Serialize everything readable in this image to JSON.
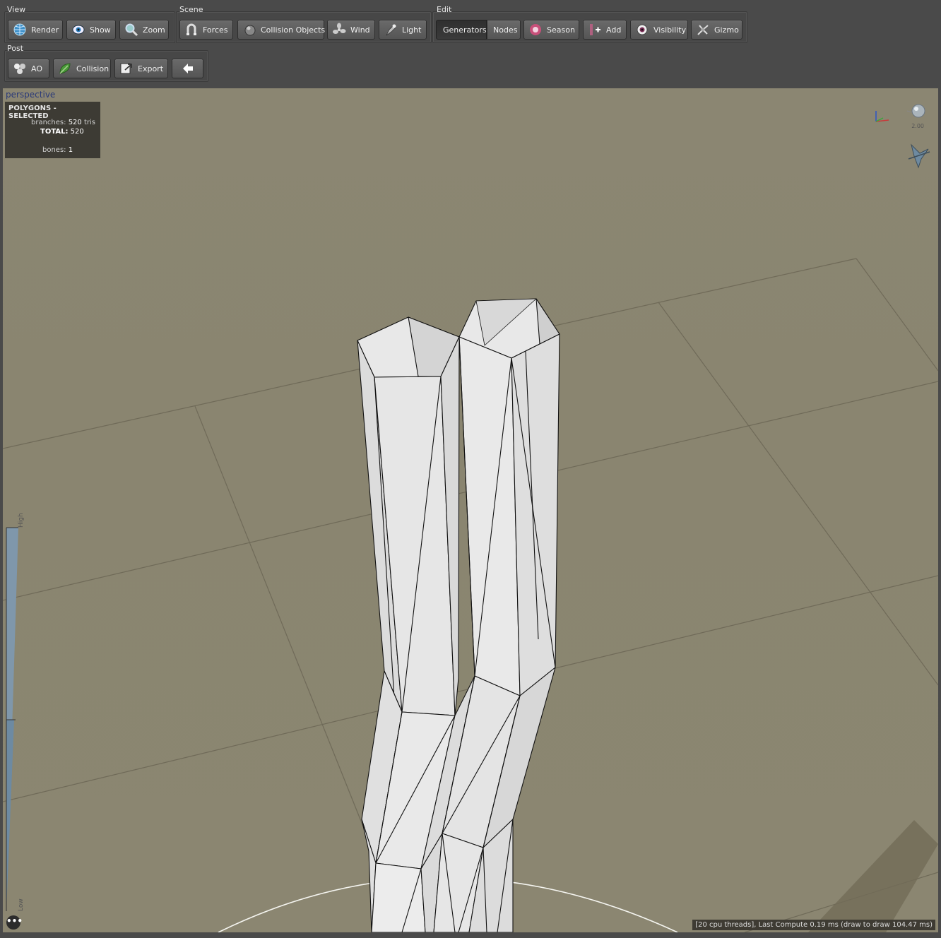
{
  "toolbar": {
    "view": {
      "title": "View",
      "buttons": [
        {
          "label": "Render",
          "icon": "globe-icon"
        },
        {
          "label": "Show",
          "icon": "eye-icon"
        },
        {
          "label": "Zoom",
          "icon": "magnifier-icon"
        }
      ]
    },
    "scene": {
      "title": "Scene",
      "buttons": [
        {
          "label": "Forces",
          "icon": "magnet-icon"
        },
        {
          "label": "Collision Objects",
          "icon": "sphere-icon"
        },
        {
          "label": "Wind",
          "icon": "fan-icon"
        },
        {
          "label": "Light",
          "icon": "lamp-icon"
        }
      ]
    },
    "edit": {
      "title": "Edit",
      "buttons": [
        {
          "label": "Generators",
          "active": true
        },
        {
          "label": "Nodes"
        },
        {
          "label": "Season",
          "icon": "season-icon"
        },
        {
          "label": "Add",
          "icon": "add-icon"
        },
        {
          "label": "Visibility",
          "icon": "eye-visibility-icon"
        },
        {
          "label": "Gizmo",
          "icon": "gizmo-icon"
        }
      ]
    },
    "post": {
      "title": "Post",
      "buttons": [
        {
          "label": "AO",
          "icon": "ao-spheres-icon"
        },
        {
          "label": "Collision",
          "icon": "leaf-icon"
        },
        {
          "label": "Export",
          "icon": "export-icon"
        },
        {
          "label": "",
          "icon": "back-arrow-icon"
        }
      ]
    }
  },
  "viewport": {
    "camera_label": "perspective",
    "stats": {
      "title": "POLYGONS - SELECTED",
      "branches_label": "branches:",
      "branches_value": "520",
      "branches_unit": "tris",
      "total_label": "TOTAL:",
      "total_value": "520",
      "bones_label": "bones:",
      "bones_value": "1"
    },
    "gizmo_scale": "2.00",
    "lod_high_label": "High",
    "lod_low_label": "Low",
    "more_button": "•••",
    "status": "[20 cpu threads], Last Compute 0.19 ms (draw to draw 104.47 ms)"
  },
  "colors": {
    "background": "#8b8671",
    "toolbar": "#4a4a4a",
    "mesh": "#e6e6e6",
    "accent": "#2a3a78"
  }
}
